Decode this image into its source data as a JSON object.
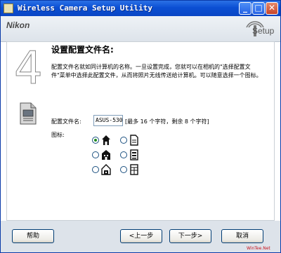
{
  "window": {
    "title": "Wireless Camera Setup Utility"
  },
  "header": {
    "brand": "Nikon",
    "setup_logo": "Setup"
  },
  "step": {
    "number": "4",
    "heading": "设置配置文件名:",
    "description": "配置文件名就如同计算机的名称。一旦设置完成，您就可以在相机的\"选择配置文件\"菜单中选择此配置文件，从而将照片无线传送给计算机。可以随意选择一个图标。"
  },
  "form": {
    "name_label": "配置文件名:",
    "name_value": "ASUS-530",
    "name_hint": "[最多 16 个字符，剩余 8 个字符]",
    "icon_label": "图标:",
    "icon_options": [
      {
        "icon": "house-icon",
        "selected": true
      },
      {
        "icon": "document-icon",
        "selected": false
      },
      {
        "icon": "office-building-icon",
        "selected": false
      },
      {
        "icon": "list-document-icon",
        "selected": false
      },
      {
        "icon": "home-office-icon",
        "selected": false
      },
      {
        "icon": "grid-document-icon",
        "selected": false
      }
    ]
  },
  "buttons": {
    "help": "帮助",
    "back": "<上一步",
    "next": "下一步>",
    "cancel": "取消"
  },
  "watermark": "WinTee.Net"
}
